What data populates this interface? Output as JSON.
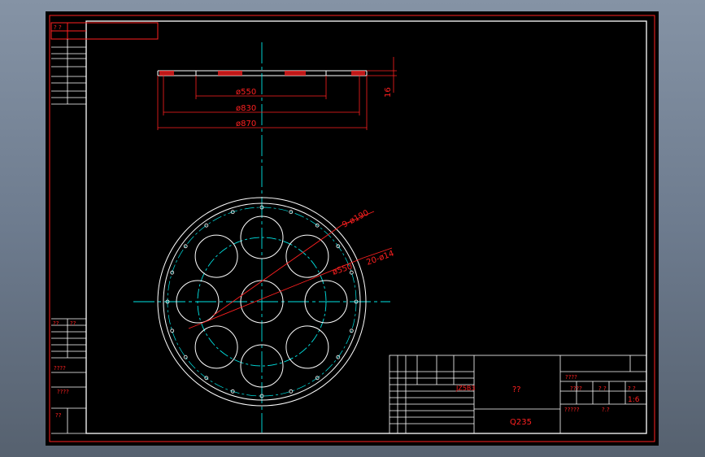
{
  "drawing": {
    "dimensions": {
      "d550": "ø550",
      "d830": "ø830",
      "d870": "ø870",
      "thickness": "16",
      "holes_large": "9-ø190",
      "holes_small": "20-ø14",
      "pcd": "ø550"
    },
    "title_block": {
      "part_name": "??",
      "material": "Q235",
      "code": "JZ5B3",
      "scale_label": "?.?",
      "ratio": "1:6",
      "row_a": "????",
      "row_b": "????",
      "row_c": "?????",
      "rev_a": "? ?",
      "rev_b": "? ?"
    },
    "sidebar": {
      "top_tag": "?   ?",
      "label_a": "??",
      "label_b": "??",
      "label_c": "????",
      "label_d": "????",
      "label_e": "??"
    },
    "colors": {
      "border": "#ff2020",
      "geometry": "#ffffff",
      "centerline": "#00e5e5",
      "dimension": "#ff2020"
    }
  }
}
